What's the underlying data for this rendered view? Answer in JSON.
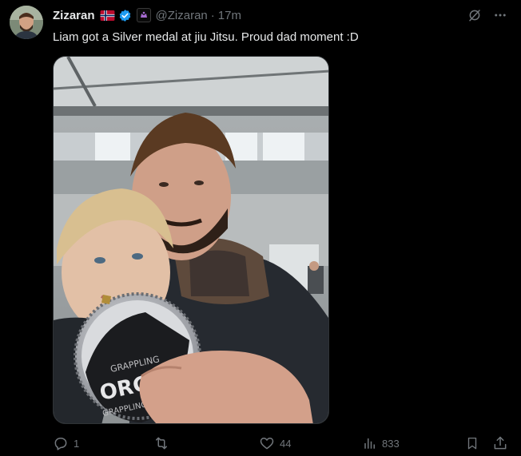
{
  "post": {
    "display_name": "Zizaran",
    "handle": "@Zizaran",
    "separator": "·",
    "time": "17m",
    "text": "Liam got a Silver medal at jiu Jitsu. Proud dad moment :D",
    "icons": {
      "avatar": "profile-photo",
      "flag": "norway-flag",
      "verified": "verified-badge-icon",
      "affiliate": "affiliate-badge-icon",
      "grok": "grok-icon",
      "more": "more-icon",
      "media_subject": "selfie-with-child-and-medal"
    },
    "medal_text": {
      "top": "GRAPPLING",
      "brand": "ORGE",
      "bottom": "GRAPPLING"
    }
  },
  "metrics": {
    "replies": "1",
    "reposts": "",
    "likes": "44",
    "views": "833"
  },
  "colors": {
    "background": "#000000",
    "text": "#e7e9ea",
    "muted": "#71767b",
    "verified": "#1d9bf0",
    "border": "#2f3336"
  }
}
